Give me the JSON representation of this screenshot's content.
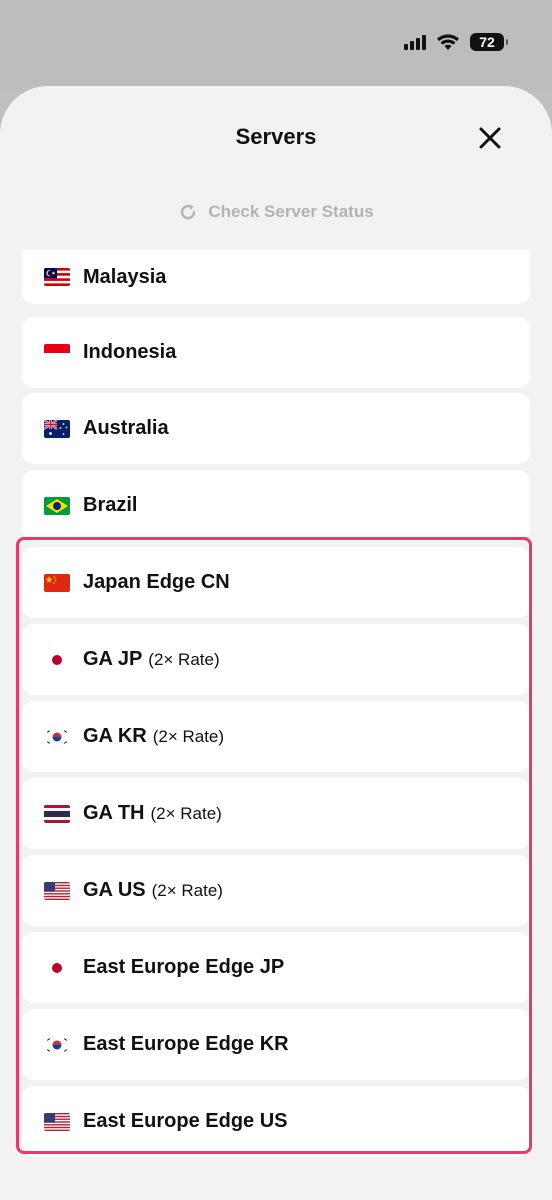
{
  "status_bar": {
    "battery_level": "72",
    "signal_icon": "cellular-signal-icon",
    "wifi_icon": "wifi-icon"
  },
  "sheet": {
    "title": "Servers",
    "close_icon": "close-icon",
    "check_status_label": "Check Server Status",
    "check_status_icon": "refresh-icon"
  },
  "servers": [
    {
      "name": "Malaysia",
      "suffix": "",
      "flag": "malaysia-flag-icon"
    },
    {
      "name": "Indonesia",
      "suffix": "",
      "flag": "indonesia-flag-icon"
    },
    {
      "name": "Australia",
      "suffix": "",
      "flag": "australia-flag-icon"
    },
    {
      "name": "Brazil",
      "suffix": "",
      "flag": "brazil-flag-icon"
    },
    {
      "name": "Japan Edge CN",
      "suffix": "",
      "flag": "china-flag-icon"
    },
    {
      "name": "GA JP",
      "suffix": "(2× Rate)",
      "flag": "japan-flag-icon"
    },
    {
      "name": "GA KR",
      "suffix": "(2× Rate)",
      "flag": "south-korea-flag-icon"
    },
    {
      "name": "GA TH",
      "suffix": "(2× Rate)",
      "flag": "thailand-flag-icon"
    },
    {
      "name": "GA US",
      "suffix": "(2× Rate)",
      "flag": "usa-flag-icon"
    },
    {
      "name": "East Europe Edge JP",
      "suffix": "",
      "flag": "japan-flag-icon"
    },
    {
      "name": "East Europe Edge KR",
      "suffix": "",
      "flag": "south-korea-flag-icon"
    },
    {
      "name": "East Europe Edge US",
      "suffix": "",
      "flag": "usa-flag-icon"
    }
  ],
  "colors": {
    "highlight_border": "#e8396a",
    "sheet_background": "#f2f2f2",
    "muted_text": "#b3b3b3"
  }
}
